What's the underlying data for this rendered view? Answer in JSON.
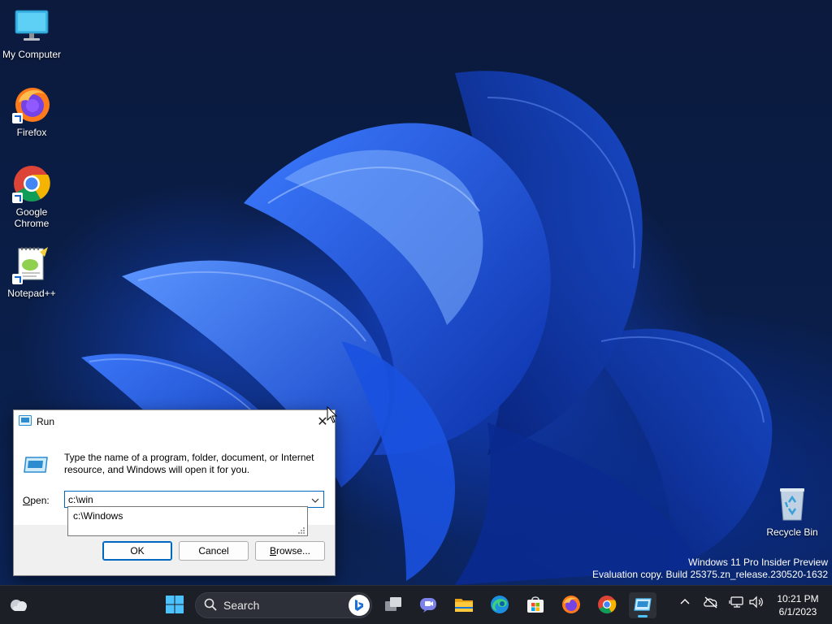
{
  "desktop": {
    "icons": [
      {
        "label": "My Computer",
        "icon": "monitor-icon"
      },
      {
        "label": "Firefox",
        "icon": "firefox-icon"
      },
      {
        "label": "Google Chrome",
        "icon": "chrome-icon"
      },
      {
        "label": "Notepad++",
        "icon": "notepadpp-icon"
      },
      {
        "label": "Recycle Bin",
        "icon": "recycle-bin-icon"
      }
    ]
  },
  "watermark": {
    "line1": "Windows 11 Pro Insider Preview",
    "line2": "Evaluation copy. Build 25375.zn_release.230520-1632"
  },
  "run_dialog": {
    "title": "Run",
    "description": "Type the name of a program, folder, document, or Internet resource, and Windows will open it for you.",
    "open_label_accel": "O",
    "open_label_rest": "pen:",
    "input_value": "c:\\win",
    "autocomplete": [
      "c:\\Windows"
    ],
    "ok_label": "OK",
    "cancel_label": "Cancel",
    "browse_label_accel": "B",
    "browse_label_rest": "rowse..."
  },
  "taskbar": {
    "search_label": "Search",
    "pinned": [
      "start",
      "search",
      "task-view",
      "teams",
      "file-explorer",
      "edge",
      "store",
      "firefox",
      "chrome",
      "run"
    ],
    "active": "run",
    "clock": {
      "time": "10:21 PM",
      "date": "6/1/2023"
    }
  },
  "colors": {
    "accent": "#0067c0",
    "taskbar": "#1c1f26",
    "indicator": "#4cc2ff"
  }
}
